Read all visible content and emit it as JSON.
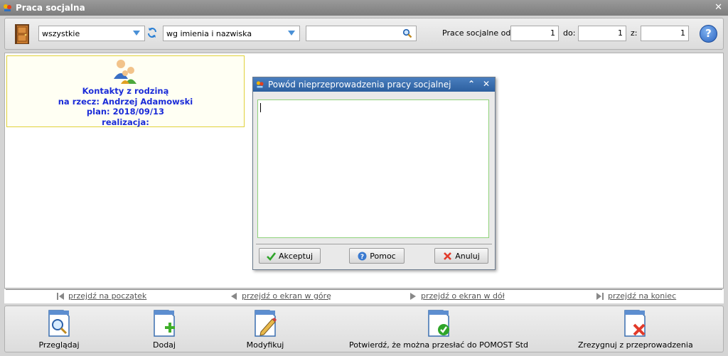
{
  "window": {
    "title": "Praca socjalna"
  },
  "toolbar": {
    "filter_value": "wszystkie",
    "sort_value": "wg imienia i nazwiska",
    "search_value": "",
    "range_label_from": "Prace socjalne od:",
    "range_from": "1",
    "range_label_to": "do:",
    "range_to": "1",
    "range_label_of": "z:",
    "range_of": "1",
    "help_label": "?"
  },
  "card": {
    "line1": "Kontakty z rodziną",
    "line2": "na rzecz: Andrzej Adamowski",
    "line3": "plan: 2018/09/13",
    "line4": "realizacja:"
  },
  "dialog": {
    "title": "Powód nieprzeprowadzenia pracy socjalnej",
    "text_value": "",
    "accept_label": "Akceptuj",
    "help_label": "Pomoc",
    "cancel_label": "Anuluj"
  },
  "nav": {
    "first": "przejdź na początek",
    "up": "przejdź o ekran w górę",
    "down": "przejdź o ekran w dół",
    "last": "przejdź na koniec"
  },
  "actions": {
    "browse": "Przeglądaj",
    "add": "Dodaj",
    "modify": "Modyfikuj",
    "confirm": "Potwierdź, że można przesłać do POMOST Std",
    "resign": "Zrezygnuj z przeprowadzenia"
  }
}
